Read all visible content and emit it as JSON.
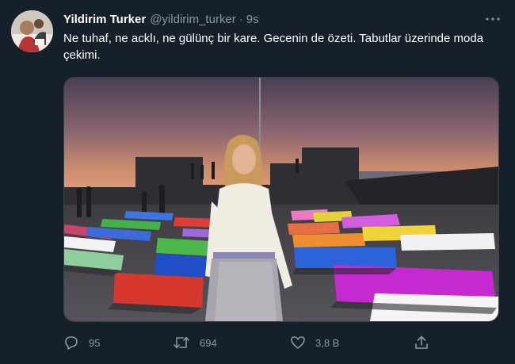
{
  "user": {
    "name": "Yildirim Turker",
    "handle": "@yildirim_turker",
    "separator": "·",
    "time": "9s"
  },
  "tweet": {
    "text": "Ne tuhaf, ne acklı, ne gülünç bir kare. Gecenin de özeti. Tabutlar üzerinde moda çekimi."
  },
  "actions": {
    "reply_count": "95",
    "retweet_count": "694",
    "like_count": "3,8 B"
  },
  "icons": {
    "more": "more-icon",
    "reply": "reply-icon",
    "retweet": "retweet-icon",
    "like": "heart-icon",
    "share": "share-icon"
  },
  "colors": {
    "background": "#15202b",
    "secondary_text": "#8899a6",
    "border": "#38444d"
  }
}
